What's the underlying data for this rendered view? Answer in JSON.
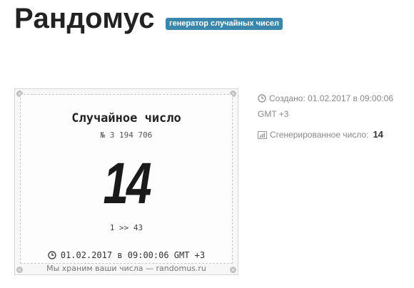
{
  "header": {
    "title": "Рандомус",
    "badge": "генератор случайных чисел"
  },
  "card": {
    "title": "Случайное число",
    "number_line": "№ 3 194 706",
    "value": "14",
    "range": "1 >> 43",
    "date": "01.02.2017 в 09:00:06 GMT +3",
    "footer": "Мы храним ваши числа — randomus.ru"
  },
  "info": {
    "created_label": "Создано:",
    "created_date": "01.02.2017 в 09:00:06 GMT +3",
    "generated_label": "Сгенерированное число:",
    "generated_value": "14"
  },
  "icons": [
    "clock-icon",
    "bar-chart-icon"
  ]
}
